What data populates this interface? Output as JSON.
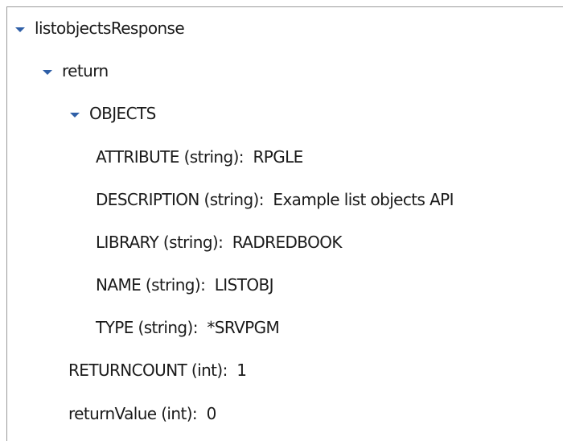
{
  "tree": {
    "root": {
      "label": "listobjectsResponse",
      "expanded": true
    },
    "return": {
      "label": "return",
      "expanded": true
    },
    "objects": {
      "label": "OBJECTS",
      "expanded": true
    },
    "attribute": {
      "name": "ATTRIBUTE (string):",
      "value": "RPGLE"
    },
    "description": {
      "name": "DESCRIPTION (string):",
      "value": "Example list objects API"
    },
    "library": {
      "name": "LIBRARY (string):",
      "value": "RADREDBOOK"
    },
    "objname": {
      "name": "NAME (string):",
      "value": "LISTOBJ"
    },
    "type": {
      "name": "TYPE (string):",
      "value": "*SRVPGM"
    },
    "returncount": {
      "name": "RETURNCOUNT (int):",
      "value": "1"
    },
    "returnvalue": {
      "name": "returnValue (int):",
      "value": "0"
    }
  },
  "colors": {
    "twisty": "#2f5fa7",
    "text": "#1a1a1a",
    "border": "#9a9a9a"
  },
  "icons": {
    "expanded": "chevron-down-icon"
  }
}
